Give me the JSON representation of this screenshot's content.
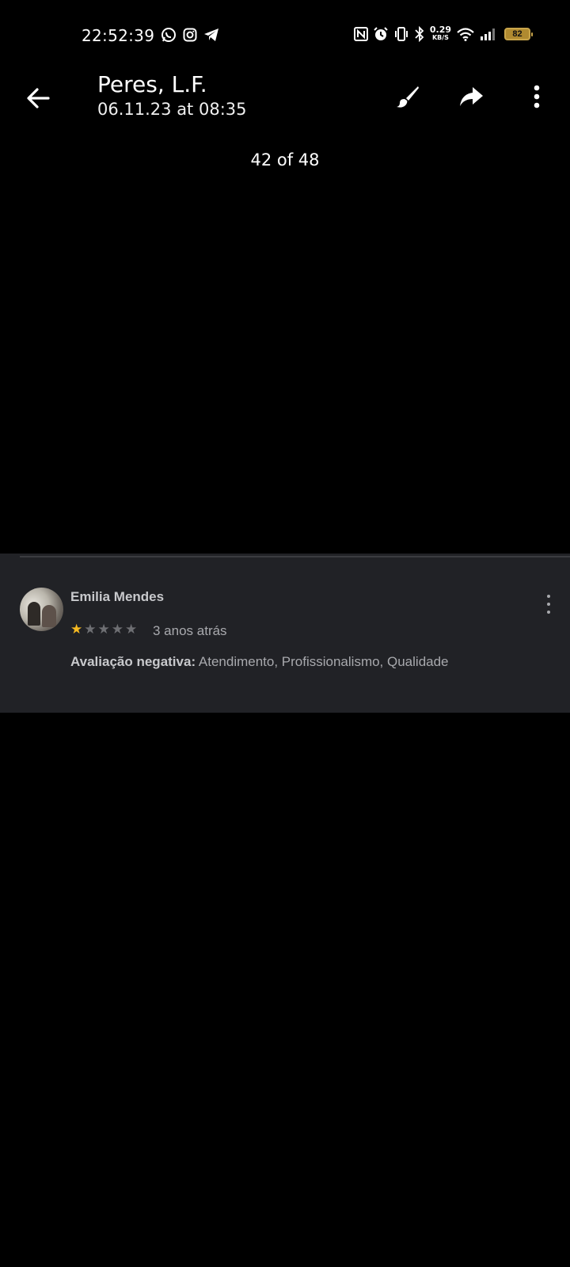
{
  "status_bar": {
    "time": "22:52:39",
    "left_icons": [
      "whatsapp-icon",
      "instagram-icon",
      "telegram-icon"
    ],
    "right_icons": [
      "nfc-icon",
      "alarm-icon",
      "vibrate-icon",
      "bluetooth-icon",
      "wifi-icon",
      "signal-icon"
    ],
    "network_speed": "0.29",
    "network_speed_unit": "KB/S",
    "battery": "82"
  },
  "app_bar": {
    "title": "Peres, L.F.",
    "subtitle": "06.11.23 at 08:35",
    "actions": [
      "back-arrow-icon",
      "brush-icon",
      "share-icon",
      "more-vert-icon"
    ]
  },
  "viewer": {
    "counter": "42 of 48"
  },
  "review": {
    "reviewer_name": "Emilia Mendes",
    "rating": 1,
    "rating_max": 5,
    "time_ago": "3 anos atrás",
    "label": "Avaliação negativa:",
    "text": " Atendimento, Profissionalismo, Qualidade"
  },
  "colors": {
    "background": "#000000",
    "card_background": "#212226",
    "star_active": "#f5b921",
    "star_inactive": "#6e6f73",
    "battery": "#b08a30"
  }
}
